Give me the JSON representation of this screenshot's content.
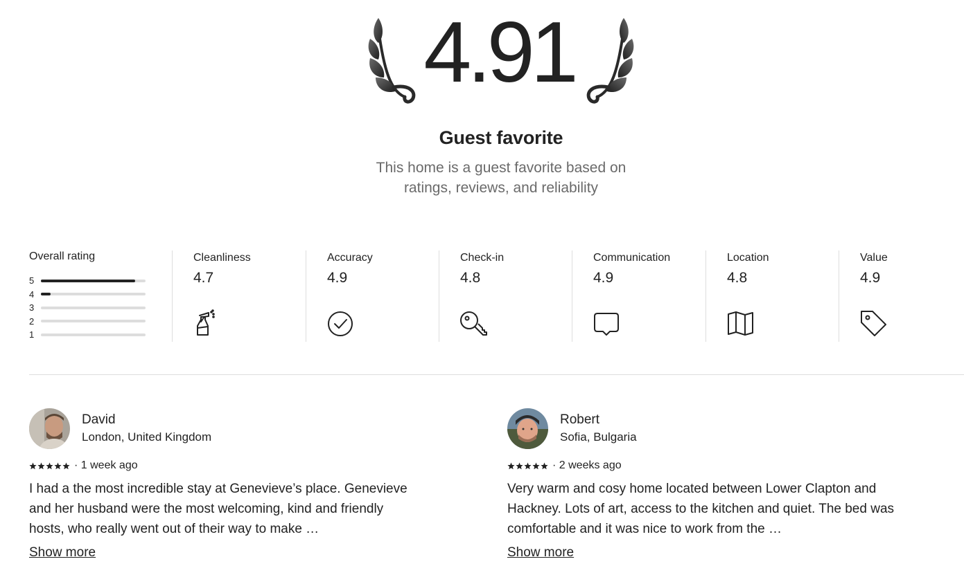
{
  "hero": {
    "score": "4.91",
    "title": "Guest favorite",
    "subtitle": "This home is a guest favorite based on ratings, reviews, and reliability"
  },
  "overall": {
    "title": "Overall rating",
    "distribution": [
      {
        "stars": "5",
        "fraction": 0.9
      },
      {
        "stars": "4",
        "fraction": 0.09
      },
      {
        "stars": "3",
        "fraction": 0
      },
      {
        "stars": "2",
        "fraction": 0
      },
      {
        "stars": "1",
        "fraction": 0
      }
    ]
  },
  "categories": [
    {
      "label": "Cleanliness",
      "score": "4.7",
      "icon": "spray-bottle-icon"
    },
    {
      "label": "Accuracy",
      "score": "4.9",
      "icon": "check-circle-icon"
    },
    {
      "label": "Check-in",
      "score": "4.8",
      "icon": "key-icon"
    },
    {
      "label": "Communication",
      "score": "4.9",
      "icon": "chat-bubble-icon"
    },
    {
      "label": "Location",
      "score": "4.8",
      "icon": "map-icon"
    },
    {
      "label": "Value",
      "score": "4.9",
      "icon": "price-tag-icon"
    }
  ],
  "reviews": [
    {
      "name": "David",
      "location": "London, United Kingdom",
      "rating": 5,
      "time": "· 1 week ago",
      "text": "I had a the most incredible stay at Genevieve’s place. Genevieve and her husband were the most welcoming, kind and friendly hosts, who really went out of their way to make …",
      "show_more": "Show more"
    },
    {
      "name": "Robert",
      "location": "Sofia, Bulgaria",
      "rating": 5,
      "time": "· 2 weeks ago",
      "text": "Very warm and cosy home located between Lower Clapton and Hackney.  Lots of art, access to the kitchen and quiet. The bed was comfortable and it was nice to work from the …",
      "show_more": "Show more"
    }
  ],
  "colors": {
    "text": "#222222",
    "muted": "#6a6a6a",
    "divider": "#dddddd",
    "bar_track": "#dddddd",
    "bar_fill": "#222222"
  }
}
